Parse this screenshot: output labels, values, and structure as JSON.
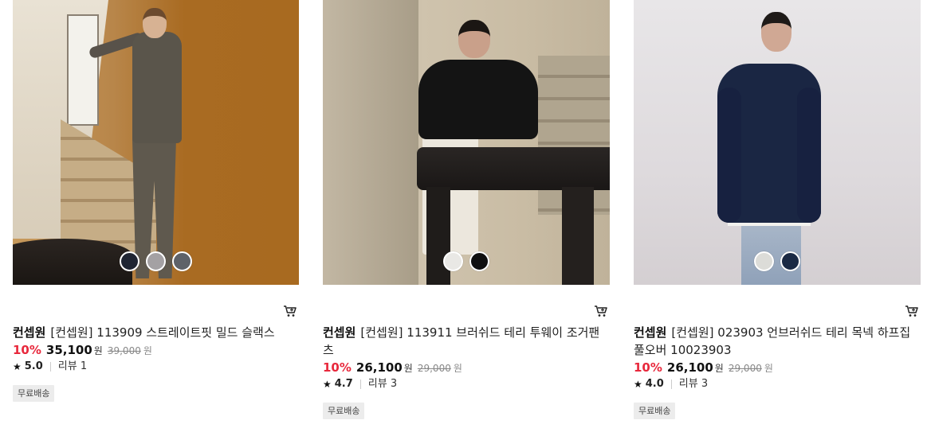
{
  "products": [
    {
      "brand": "컨셉원",
      "name": "[컨셉원] 113909 스트레이트핏 밀드 슬랙스",
      "discount": "10%",
      "price": "35,100",
      "currency": "원",
      "original_price": "39,000",
      "rating": "5.0",
      "reviews": "리뷰 1",
      "badge": "무료배송",
      "swatches": [
        "#1f2533",
        "#a4a1a3",
        "#5e6269"
      ]
    },
    {
      "brand": "컨셉원",
      "name": "[컨셉원] 113911 브러쉬드 테리 투웨이 조거팬츠",
      "discount": "10%",
      "price": "26,100",
      "currency": "원",
      "original_price": "29,000",
      "rating": "4.7",
      "reviews": "리뷰 3",
      "badge": "무료배송",
      "swatches": [
        "#e9e8e5",
        "#0f0f10"
      ]
    },
    {
      "brand": "컨셉원",
      "name": "[컨셉원] 023903 언브러쉬드 테리 목넥 하프집 풀오버 10023903",
      "discount": "10%",
      "price": "26,100",
      "currency": "원",
      "original_price": "29,000",
      "rating": "4.0",
      "reviews": "리뷰 3",
      "badge": "무료배송",
      "swatches": [
        "#dcdcd8",
        "#1b2a44"
      ]
    }
  ],
  "colors": {
    "discount": "#e8283c",
    "badge_bg": "#ececec"
  },
  "icons": {
    "cart": "cart-icon",
    "star": "star-icon"
  }
}
